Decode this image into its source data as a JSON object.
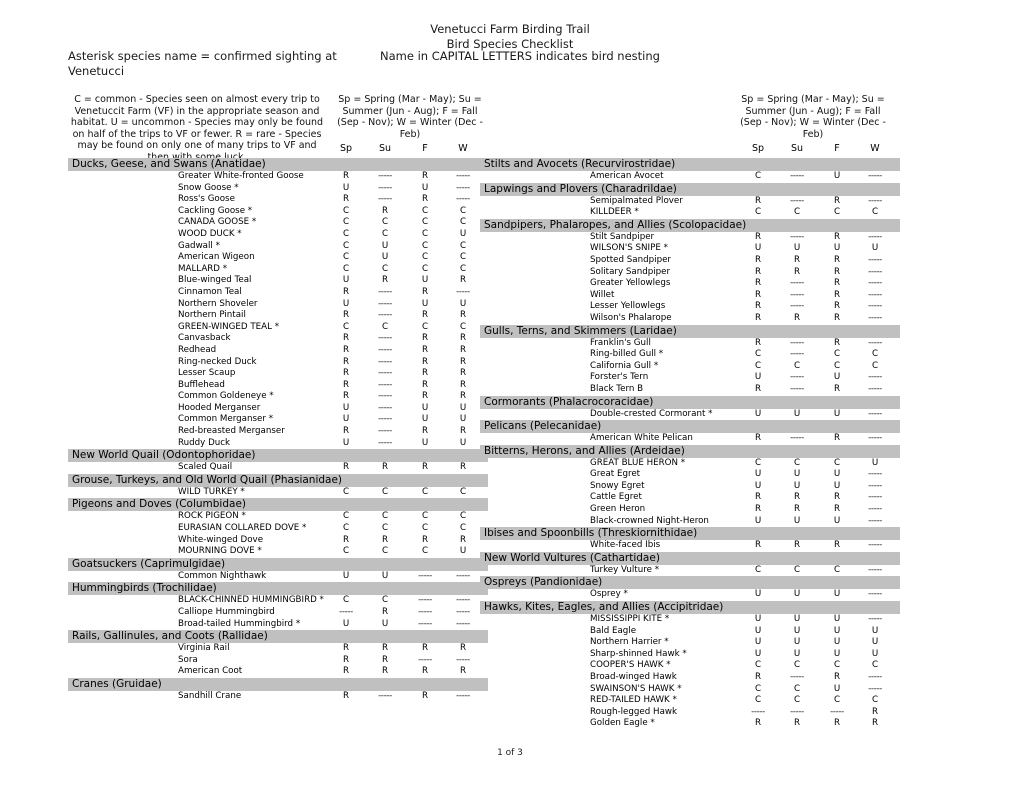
{
  "document": {
    "title_lines": [
      "Venetucci Farm Birding Trail",
      "Bird Species Checklist"
    ],
    "subtitle_left": "Asterisk species name = confirmed sighting at Venetucci",
    "subtitle_right": "Name in CAPITAL LETTERS indicates bird nesting",
    "footer": "1 of 3"
  },
  "legend": {
    "abundance": "C = common - Species seen on almost every trip to Venetuccit Farm (VF) in the appropriate season and habitat.  U = uncommon - Species may only be found on half of the trips to VF or fewer.  R = rare - Species may be found on only one of many trips to VF and then with some luck.",
    "seasons": "Sp = Spring (Mar - May); Su = Summer (Jun - Aug); F = Fall (Sep - Nov); W = Winter (Dec - Feb)",
    "columns": [
      "Sp",
      "Su",
      "F",
      "W"
    ]
  },
  "columns_left": [
    {
      "family": "Ducks, Geese, and Swans (Anatidae)",
      "species": [
        {
          "name": "Greater White-fronted Goose",
          "sp": "R",
          "su": "-----",
          "f": "R",
          "w": "-----"
        },
        {
          "name": "Snow Goose *",
          "sp": "U",
          "su": "-----",
          "f": "U",
          "w": "-----"
        },
        {
          "name": "Ross's Goose",
          "sp": "R",
          "su": "-----",
          "f": "R",
          "w": "-----"
        },
        {
          "name": "Cackling Goose *",
          "sp": "C",
          "su": "R",
          "f": "C",
          "w": "C"
        },
        {
          "name": "CANADA GOOSE *",
          "sp": "C",
          "su": "C",
          "f": "C",
          "w": "C"
        },
        {
          "name": "WOOD DUCK *",
          "sp": "C",
          "su": "C",
          "f": "C",
          "w": "U"
        },
        {
          "name": "Gadwall *",
          "sp": "C",
          "su": "U",
          "f": "C",
          "w": "C"
        },
        {
          "name": "American Wigeon",
          "sp": "C",
          "su": "U",
          "f": "C",
          "w": "C"
        },
        {
          "name": "MALLARD *",
          "sp": "C",
          "su": "C",
          "f": "C",
          "w": "C"
        },
        {
          "name": "Blue-winged Teal",
          "sp": "U",
          "su": "R",
          "f": "U",
          "w": "R"
        },
        {
          "name": "Cinnamon Teal",
          "sp": "R",
          "su": "-----",
          "f": "R",
          "w": "-----"
        },
        {
          "name": "Northern Shoveler",
          "sp": "U",
          "su": "-----",
          "f": "U",
          "w": "U"
        },
        {
          "name": "Northern Pintail",
          "sp": "R",
          "su": "-----",
          "f": "R",
          "w": "R"
        },
        {
          "name": "GREEN-WINGED TEAL *",
          "sp": "C",
          "su": "C",
          "f": "C",
          "w": "C"
        },
        {
          "name": "Canvasback",
          "sp": "R",
          "su": "-----",
          "f": "R",
          "w": "R"
        },
        {
          "name": "Redhead",
          "sp": "R",
          "su": "-----",
          "f": "R",
          "w": "R"
        },
        {
          "name": "Ring-necked Duck",
          "sp": "R",
          "su": "-----",
          "f": "R",
          "w": "R"
        },
        {
          "name": "Lesser Scaup",
          "sp": "R",
          "su": "-----",
          "f": "R",
          "w": "R"
        },
        {
          "name": "Bufflehead",
          "sp": "R",
          "su": "-----",
          "f": "R",
          "w": "R"
        },
        {
          "name": "Common Goldeneye *",
          "sp": "R",
          "su": "-----",
          "f": "R",
          "w": "R"
        },
        {
          "name": "Hooded Merganser",
          "sp": "U",
          "su": "-----",
          "f": "U",
          "w": "U"
        },
        {
          "name": "Common Merganser *",
          "sp": "U",
          "su": "-----",
          "f": "U",
          "w": "U"
        },
        {
          "name": "Red-breasted Merganser",
          "sp": "R",
          "su": "-----",
          "f": "R",
          "w": "R"
        },
        {
          "name": "Ruddy Duck",
          "sp": "U",
          "su": "-----",
          "f": "U",
          "w": "U"
        }
      ]
    },
    {
      "family": "New World Quail (Odontophoridae)",
      "species": [
        {
          "name": "Scaled Quail",
          "sp": "R",
          "su": "R",
          "f": "R",
          "w": "R"
        }
      ]
    },
    {
      "family": "Grouse, Turkeys, and Old World Quail (Phasianidae)",
      "species": [
        {
          "name": "WILD TURKEY *",
          "sp": "C",
          "su": "C",
          "f": "C",
          "w": "C"
        }
      ]
    },
    {
      "family": "Pigeons and Doves (Columbidae)",
      "species": [
        {
          "name": "ROCK PIGEON *",
          "sp": "C",
          "su": "C",
          "f": "C",
          "w": "C"
        },
        {
          "name": "EURASIAN COLLARED DOVE *",
          "sp": "C",
          "su": "C",
          "f": "C",
          "w": "C"
        },
        {
          "name": "White-winged Dove",
          "sp": "R",
          "su": "R",
          "f": "R",
          "w": "R"
        },
        {
          "name": "MOURNING DOVE *",
          "sp": "C",
          "su": "C",
          "f": "C",
          "w": "U"
        }
      ]
    },
    {
      "family": "Goatsuckers (Caprimulgidae)",
      "species": [
        {
          "name": "Common Nighthawk",
          "sp": "U",
          "su": "U",
          "f": "-----",
          "w": "-----"
        }
      ]
    },
    {
      "family": "Hummingbirds (Trochilidae)",
      "species": [
        {
          "name": "BLACK-CHINNED HUMMINGBIRD *",
          "sp": "C",
          "su": "C",
          "f": "-----",
          "w": "-----"
        },
        {
          "name": "Calliope Hummingbird",
          "sp": "-----",
          "su": "R",
          "f": "-----",
          "w": "-----"
        },
        {
          "name": "Broad-tailed Hummingbird *",
          "sp": "U",
          "su": "U",
          "f": "-----",
          "w": "-----"
        }
      ]
    },
    {
      "family": "Rails, Gallinules, and Coots (Rallidae)",
      "species": [
        {
          "name": "Virginia Rail",
          "sp": "R",
          "su": "R",
          "f": "R",
          "w": "R"
        },
        {
          "name": "Sora",
          "sp": "R",
          "su": "R",
          "f": "-----",
          "w": "-----"
        },
        {
          "name": "American Coot",
          "sp": "R",
          "su": "R",
          "f": "R",
          "w": "R"
        }
      ]
    },
    {
      "family": "Cranes (Gruidae)",
      "species": [
        {
          "name": "Sandhill Crane",
          "sp": "R",
          "su": "-----",
          "f": "R",
          "w": "-----"
        }
      ]
    }
  ],
  "columns_right": [
    {
      "family": "Stilts and Avocets (Recurvirostridae)",
      "species": [
        {
          "name": "American Avocet",
          "sp": "C",
          "su": "-----",
          "f": "U",
          "w": "-----"
        }
      ]
    },
    {
      "family": "Lapwings and Plovers (Charadrildae)",
      "species": [
        {
          "name": "Semipalmated Plover",
          "sp": "R",
          "su": "-----",
          "f": "R",
          "w": "-----"
        },
        {
          "name": "KILLDEER *",
          "sp": "C",
          "su": "C",
          "f": "C",
          "w": "C"
        }
      ]
    },
    {
      "family": "Sandpipers, Phalaropes, and Allies (Scolopacidae)",
      "species": [
        {
          "name": "Stilt Sandpiper",
          "sp": "R",
          "su": "-----",
          "f": "R",
          "w": "-----"
        },
        {
          "name": "WILSON'S SNIPE *",
          "sp": "U",
          "su": "U",
          "f": "U",
          "w": "U"
        },
        {
          "name": "Spotted Sandpiper",
          "sp": "R",
          "su": "R",
          "f": "R",
          "w": "-----"
        },
        {
          "name": "Solitary Sandpiper",
          "sp": "R",
          "su": "R",
          "f": "R",
          "w": "-----"
        },
        {
          "name": "Greater Yellowlegs",
          "sp": "R",
          "su": "-----",
          "f": "R",
          "w": "-----"
        },
        {
          "name": "Willet",
          "sp": "R",
          "su": "-----",
          "f": "R",
          "w": "-----"
        },
        {
          "name": "Lesser Yellowlegs",
          "sp": "R",
          "su": "-----",
          "f": "R",
          "w": "-----"
        },
        {
          "name": "Wilson's Phalarope",
          "sp": "R",
          "su": "R",
          "f": "R",
          "w": "-----"
        }
      ]
    },
    {
      "family": "Gulls, Terns, and Skimmers (Laridae)",
      "species": [
        {
          "name": "Franklin's Gull",
          "sp": "R",
          "su": "-----",
          "f": "R",
          "w": "-----"
        },
        {
          "name": "Ring-billed Gull *",
          "sp": "C",
          "su": "-----",
          "f": "C",
          "w": "C"
        },
        {
          "name": "California Gull *",
          "sp": "C",
          "su": "C",
          "f": "C",
          "w": "C"
        },
        {
          "name": "Forster's Tern",
          "sp": "U",
          "su": "-----",
          "f": "U",
          "w": "-----"
        },
        {
          "name": "Black Tern B",
          "sp": "R",
          "su": "-----",
          "f": "R",
          "w": "-----"
        }
      ]
    },
    {
      "family": "Cormorants (Phalacrocoracidae)",
      "species": [
        {
          "name": "Double-crested Cormorant *",
          "sp": "U",
          "su": "U",
          "f": "U",
          "w": "-----"
        }
      ]
    },
    {
      "family": "Pelicans (Pelecanidae)",
      "species": [
        {
          "name": "American White Pelican",
          "sp": "R",
          "su": "-----",
          "f": "R",
          "w": "-----"
        }
      ]
    },
    {
      "family": "Bitterns, Herons, and Allies (Ardeidae)",
      "species": [
        {
          "name": "GREAT BLUE HERON *",
          "sp": "C",
          "su": "C",
          "f": "C",
          "w": "U"
        },
        {
          "name": "Great Egret",
          "sp": "U",
          "su": "U",
          "f": "U",
          "w": "-----"
        },
        {
          "name": "Snowy Egret",
          "sp": "U",
          "su": "U",
          "f": "U",
          "w": "-----"
        },
        {
          "name": "Cattle Egret",
          "sp": "R",
          "su": "R",
          "f": "R",
          "w": "-----"
        },
        {
          "name": "Green Heron",
          "sp": "R",
          "su": "R",
          "f": "R",
          "w": "-----"
        },
        {
          "name": "Black-crowned Night-Heron",
          "sp": "U",
          "su": "U",
          "f": "U",
          "w": "-----"
        }
      ]
    },
    {
      "family": "Ibises and Spoonbills (Threskiornithidae)",
      "species": [
        {
          "name": "White-faced Ibis",
          "sp": "R",
          "su": "R",
          "f": "R",
          "w": "-----"
        }
      ]
    },
    {
      "family": "New World Vultures (Cathartidae)",
      "species": [
        {
          "name": "Turkey Vulture *",
          "sp": "C",
          "su": "C",
          "f": "C",
          "w": "-----"
        }
      ]
    },
    {
      "family": "Ospreys (Pandionidae)",
      "species": [
        {
          "name": "Osprey *",
          "sp": "U",
          "su": "U",
          "f": "U",
          "w": "-----"
        }
      ]
    },
    {
      "family": "Hawks, Kites, Eagles, and Allies (Accipitridae)",
      "species": [
        {
          "name": "MISSISSIPPI KITE *",
          "sp": "U",
          "su": "U",
          "f": "U",
          "w": "-----"
        },
        {
          "name": "Bald Eagle",
          "sp": "U",
          "su": "U",
          "f": "U",
          "w": "U"
        },
        {
          "name": "Northern Harrier *",
          "sp": "U",
          "su": "U",
          "f": "U",
          "w": "U"
        },
        {
          "name": "Sharp-shinned Hawk *",
          "sp": "U",
          "su": "U",
          "f": "U",
          "w": "U"
        },
        {
          "name": "COOPER'S HAWK *",
          "sp": "C",
          "su": "C",
          "f": "C",
          "w": "C"
        },
        {
          "name": "Broad-winged Hawk",
          "sp": "R",
          "su": "-----",
          "f": "R",
          "w": "-----"
        },
        {
          "name": "SWAINSON'S HAWK *",
          "sp": "C",
          "su": "C",
          "f": "U",
          "w": "-----"
        },
        {
          "name": "RED-TAILED HAWK *",
          "sp": "C",
          "su": "C",
          "f": "C",
          "w": "C"
        },
        {
          "name": "Rough-legged Hawk",
          "sp": "-----",
          "su": "-----",
          "f": "-----",
          "w": "R"
        },
        {
          "name": "Golden Eagle *",
          "sp": "R",
          "su": "R",
          "f": "R",
          "w": "R"
        }
      ]
    }
  ]
}
